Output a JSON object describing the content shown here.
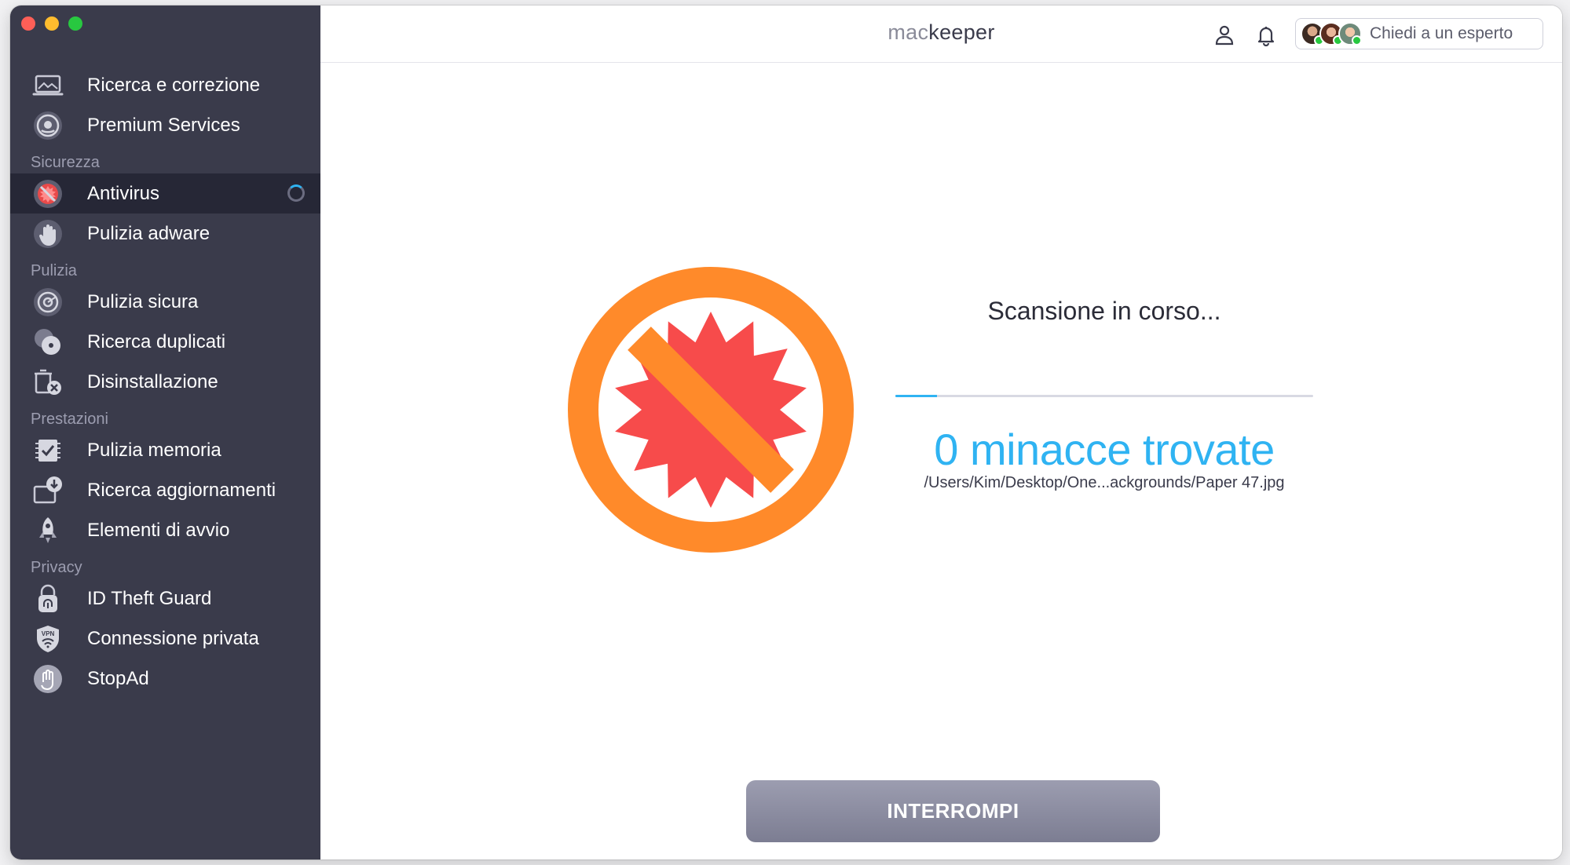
{
  "window": {
    "controls": [
      "close",
      "minimize",
      "zoom"
    ]
  },
  "header": {
    "logo_prefix": "mac",
    "logo_suffix": "keeper",
    "expert_button_label": "Chiedi a un esperto",
    "icons": {
      "account": "user-icon",
      "notifications": "bell-icon"
    }
  },
  "sidebar": {
    "top_items": [
      {
        "label": "Ricerca e correzione",
        "icon": "laptop-scan-icon"
      },
      {
        "label": "Premium Services",
        "icon": "headset-icon"
      }
    ],
    "sections": [
      {
        "title": "Sicurezza",
        "items": [
          {
            "label": "Antivirus",
            "icon": "antivirus-icon",
            "active": true,
            "status": "scanning"
          },
          {
            "label": "Pulizia adware",
            "icon": "hand-stop-icon"
          }
        ]
      },
      {
        "title": "Pulizia",
        "items": [
          {
            "label": "Pulizia sicura",
            "icon": "disk-clean-icon"
          },
          {
            "label": "Ricerca duplicati",
            "icon": "duplicates-icon"
          },
          {
            "label": "Disinstallazione",
            "icon": "uninstall-icon"
          }
        ]
      },
      {
        "title": "Prestazioni",
        "items": [
          {
            "label": "Pulizia memoria",
            "icon": "memory-check-icon"
          },
          {
            "label": "Ricerca aggiornamenti",
            "icon": "update-download-icon"
          },
          {
            "label": "Elementi di avvio",
            "icon": "rocket-icon"
          }
        ]
      },
      {
        "title": "Privacy",
        "items": [
          {
            "label": "ID Theft Guard",
            "icon": "fingerprint-lock-icon"
          },
          {
            "label": "Connessione privata",
            "icon": "vpn-shield-icon"
          },
          {
            "label": "StopAd",
            "icon": "stopad-hand-icon"
          }
        ]
      }
    ],
    "vpn_icon_text": "VPN"
  },
  "main": {
    "status_title": "Scansione in corso...",
    "progress": 0.1,
    "threats_text": "0 minacce trovate",
    "scan_path": "/Users/Kim/Desktop/One...ackgrounds/Paper 47.jpg",
    "stop_button_label": "INTERROMPI",
    "hero_icon": "virus-blocked-icon"
  },
  "colors": {
    "sidebar_bg": "#3a3b4b",
    "sidebar_active_bg": "#262736",
    "accent": "#2fb3f2",
    "hero_orange": "#ff8a2a",
    "hero_red": "#f74b4b",
    "button_gray": "#8c8da1"
  }
}
